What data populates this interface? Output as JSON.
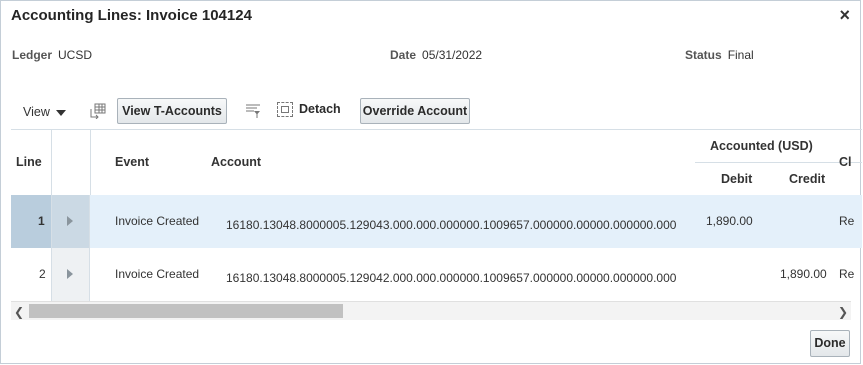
{
  "dialog": {
    "title": "Accounting Lines: Invoice 104124",
    "close_icon": "×"
  },
  "meta": {
    "ledger_label": "Ledger",
    "ledger_value": "UCSD",
    "date_label": "Date",
    "date_value": "05/31/2022",
    "status_label": "Status",
    "status_value": "Final"
  },
  "toolbar": {
    "view_label": "View",
    "view_t_accounts_label": "View T-Accounts",
    "detach_label": "Detach",
    "override_account_label": "Override Account"
  },
  "table": {
    "headers": {
      "line": "Line",
      "event": "Event",
      "account": "Account",
      "accounted": "Accounted (USD)",
      "debit": "Debit",
      "credit": "Credit",
      "cl_partial": "Cl"
    },
    "rows": [
      {
        "line": "1",
        "event": "Invoice Created",
        "account": "16180.13048.8000005.129043.000.000.000000.1009657.000000.00000.000000.000",
        "debit": "1,890.00",
        "credit": "",
        "cl": "Re"
      },
      {
        "line": "2",
        "event": "Invoice Created",
        "account": "16180.13048.8000005.129042.000.000.000000.1009657.000000.00000.000000.000",
        "debit": "",
        "credit": "1,890.00",
        "cl": "Re"
      }
    ]
  },
  "footer": {
    "done_label": "Done"
  },
  "colors": {
    "selected_row": "#e4f0fa",
    "selected_rownum": "#b9cddd",
    "border": "#d6dfe6"
  }
}
